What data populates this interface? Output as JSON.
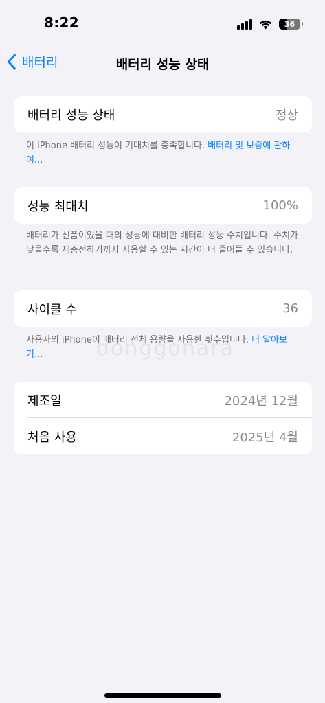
{
  "status_bar": {
    "time": "8:22",
    "battery_level": "36",
    "battery_fraction": 0.36,
    "icons": [
      "signal-icon",
      "wifi-icon",
      "battery-icon"
    ]
  },
  "nav": {
    "back_label": "배터리",
    "title": "배터리 성능 상태"
  },
  "sections": {
    "health": {
      "label": "배터리 성능 상태",
      "value": "정상",
      "footnote_text": "이 iPhone 배터리 성능이 기대치를 충족합니다. ",
      "footnote_link": "배터리 및 보증에 관하여..."
    },
    "capacity": {
      "label": "성능 최대치",
      "value": "100%",
      "footnote": "배터리가 신품이었을 때의 성능에 대비한 배터리 성능 수치입니다. 수치가 낮을수록 재충전하기까지 사용할 수 있는 시간이 더 줄어들 수 있습니다."
    },
    "cycles": {
      "label": "사이클 수",
      "value": "36",
      "footnote_text": "사용자의 iPhone이 배터리 전체 용량을 사용한 횟수입니다. ",
      "footnote_link": "더 알아보기..."
    },
    "dates": {
      "manufacture_label": "제조일",
      "manufacture_value": "2024년 12월",
      "first_use_label": "처음 사용",
      "first_use_value": "2025년 4월"
    }
  },
  "watermark": "donggonara",
  "colors": {
    "accent": "#0a84ff",
    "background": "#f2f2f7",
    "secondary_text": "#8a8a8e"
  }
}
